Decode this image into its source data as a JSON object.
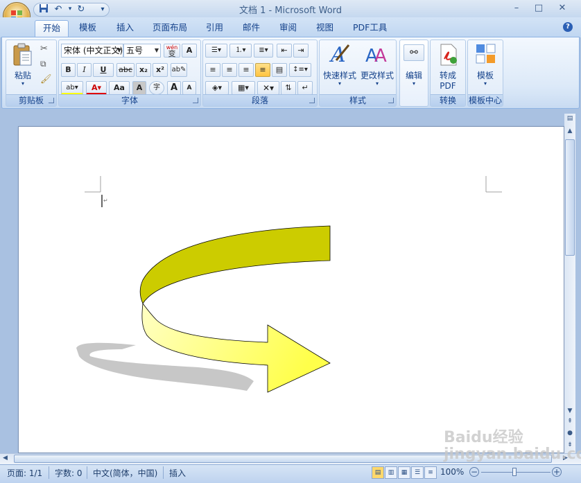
{
  "window": {
    "title": "文档 1 - Microsoft Word",
    "minimize": "–",
    "maximize": "□",
    "close": "✕"
  },
  "qat": {
    "save_icon": "save-icon",
    "undo_icon": "undo-icon",
    "redo_icon": "redo-icon",
    "customize": "▾"
  },
  "tabs": [
    "开始",
    "模板",
    "插入",
    "页面布局",
    "引用",
    "邮件",
    "审阅",
    "视图",
    "PDF工具"
  ],
  "active_tab": "开始",
  "help": "?",
  "ribbon": {
    "clipboard": {
      "label": "剪贴板",
      "paste": "粘贴"
    },
    "font": {
      "label": "字体",
      "font_name": "宋体 (中文正文)",
      "font_size": "五号",
      "wen": "wén",
      "bold": "B",
      "italic": "I",
      "underline": "U",
      "strike": "abc",
      "subscript": "x₂",
      "superscript": "x²",
      "char_border": "A",
      "grow": "A",
      "shrink": "A",
      "case": "Aa",
      "char_shade": "A",
      "enclose": "字"
    },
    "paragraph": {
      "label": "段落"
    },
    "styles": {
      "label": "样式",
      "quick_styles": "快速样式",
      "change_styles": "更改样式"
    },
    "editing": {
      "label": "编辑"
    },
    "convert": {
      "label": "转换",
      "to_pdf_line1": "转成",
      "to_pdf_line2": "PDF"
    },
    "templates": {
      "label": "模板中心",
      "template": "模板"
    }
  },
  "status": {
    "page": "页面: 1/1",
    "words": "字数: 0",
    "language": "中文(简体，中国)",
    "mode": "插入",
    "zoom": "100%"
  },
  "watermark": "Baidu经验\njingyan.baidu.com",
  "colors": {
    "arrow_top": "#cccc00",
    "arrow_front_light": "#ffffc4",
    "arrow_front_dark": "#ffff4a",
    "shadow": "#c4c4c4",
    "ribbon_accent": "#15428b"
  }
}
